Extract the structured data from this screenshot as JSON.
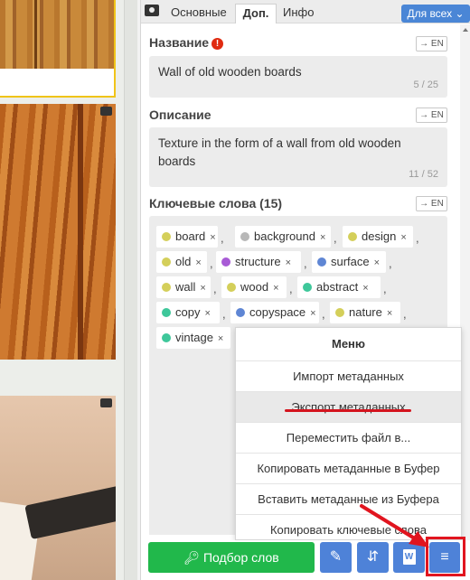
{
  "tabs": {
    "main": "Основные",
    "extra": "Доп.",
    "info": "Инфо"
  },
  "scope_button": "Для всех",
  "sections": {
    "title_label": "Название",
    "title_value": "Wall of old wooden boards",
    "title_counter": "5 / 25",
    "description_label": "Описание",
    "description_value": "Texture in the form of a wall from old wooden boards",
    "description_counter": "11 / 52",
    "keywords_label": "Ключевые слова (15)",
    "en_label": "→ EN",
    "warning_symbol": "!"
  },
  "keywords": [
    {
      "text": "board",
      "color": "#d4cf5a"
    },
    {
      "text": "background",
      "color": "#b8b8b8"
    },
    {
      "text": "design",
      "color": "#d4cf5a"
    },
    {
      "text": "old",
      "color": "#d4cf5a"
    },
    {
      "text": "structure",
      "color": "#a85bd6"
    },
    {
      "text": "surface",
      "color": "#5f86d4"
    },
    {
      "text": "wall",
      "color": "#d4cf5a"
    },
    {
      "text": "wood",
      "color": "#d4cf5a"
    },
    {
      "text": "abstract",
      "color": "#3ec79a"
    },
    {
      "text": "copy",
      "color": "#3ec79a"
    },
    {
      "text": "copyspace",
      "color": "#5f86d4"
    },
    {
      "text": "nature",
      "color": "#d4cf5a"
    },
    {
      "text": "vintage",
      "color": "#3ec79a"
    }
  ],
  "chip_remove": "×",
  "chip_separator": ",",
  "menu": {
    "title": "Меню",
    "items": [
      "Импорт метаданных",
      "Экспорт метаданных",
      "Переместить файл в...",
      "Копировать метаданные в Буфер",
      "Вставить метаданные из Буфера",
      "Копировать ключевые слова"
    ],
    "highlighted_index": 1
  },
  "toolbar": {
    "match_words": "Подбор слов",
    "doc_badge": "W"
  },
  "colors": {
    "accent_blue": "#4e82d8",
    "green": "#21b84b",
    "annotation_red": "#e1151f"
  }
}
